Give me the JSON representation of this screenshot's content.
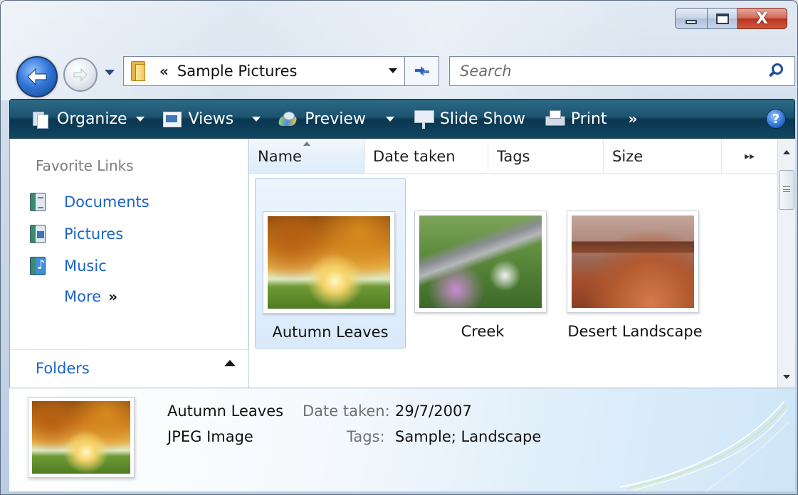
{
  "window": {
    "caption_buttons": [
      "minimize",
      "maximize",
      "close"
    ],
    "close_glyph": "X"
  },
  "nav": {
    "address_chevrons": "«",
    "address_text": "Sample Pictures",
    "search_placeholder": "Search"
  },
  "command_bar": {
    "organize": "Organize",
    "views": "Views",
    "preview": "Preview",
    "slide_show": "Slide Show",
    "print": "Print",
    "more": "»",
    "help": "?"
  },
  "nav_pane": {
    "title": "Favorite Links",
    "links": [
      {
        "label": "Documents",
        "icon": "documents-icon"
      },
      {
        "label": "Pictures",
        "icon": "pictures-icon"
      },
      {
        "label": "Music",
        "icon": "music-icon"
      }
    ],
    "more_label": "More",
    "more_chevron": "»",
    "folders_label": "Folders"
  },
  "file_list": {
    "columns": [
      "Name",
      "Date taken",
      "Tags",
      "Size"
    ],
    "sorted_column": "Name",
    "overflow": "▸▸",
    "items": [
      {
        "name": "Autumn Leaves",
        "selected": true
      },
      {
        "name": "Creek",
        "selected": false
      },
      {
        "name": "Desert Landscape",
        "selected": false
      }
    ]
  },
  "details": {
    "name": "Autumn Leaves",
    "type": "JPEG Image",
    "date_taken_label": "Date taken:",
    "date_taken_value": "29/7/2007",
    "tags_label": "Tags:",
    "tags_value": "Sample; Landscape"
  },
  "colors": {
    "command_bar": "#1c5470",
    "link": "#1b63c7",
    "selection": "#daeafb"
  }
}
